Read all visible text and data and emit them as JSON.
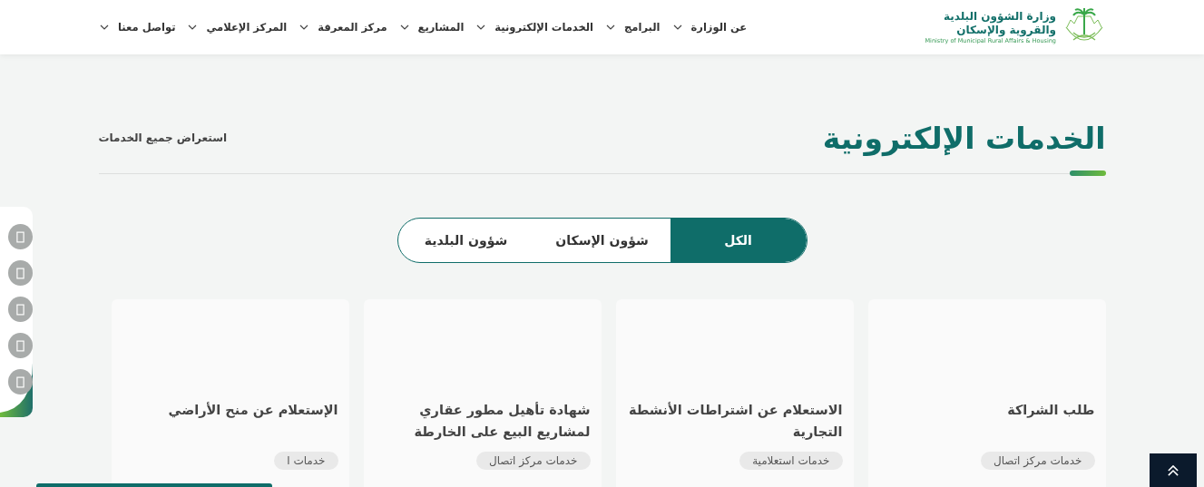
{
  "header": {
    "logo": {
      "name_line_1": "وزارة الشؤون البلدية",
      "name_line_2": "والقروية والإسكان",
      "english": "Ministry of Municipal Rural Affairs & Housing"
    },
    "nav": [
      {
        "label": "عن الوزارة"
      },
      {
        "label": "البرامج"
      },
      {
        "label": "الخدمات الإلكترونية"
      },
      {
        "label": "المشاريع"
      },
      {
        "label": "مركز المعرفة"
      },
      {
        "label": "المركز الإعلامي"
      },
      {
        "label": "تواصل معنا"
      }
    ]
  },
  "section": {
    "title": "الخدمات الإلكترونية",
    "view_all": "استعراض جميع الخدمات"
  },
  "tabs": [
    {
      "label": "الكل",
      "selected": true
    },
    {
      "label": "شؤون الإسكان",
      "selected": false
    },
    {
      "label": "شؤون البلدية",
      "selected": false
    }
  ],
  "cards": [
    {
      "title": "طلب الشراكة",
      "tag": "خدمات مركز اتصال"
    },
    {
      "title": "الاستعلام عن اشتراطات الأنشطة التجارية",
      "tag": "خدمات استعلامية"
    },
    {
      "title": "شهادة تأهيل مطور عقاري لمشاريع البيع على الخارطة",
      "tag": "خدمات مركز اتصال"
    },
    {
      "title": "الإستعلام عن منح الأراضي",
      "tag": "خدمات ا"
    }
  ]
}
